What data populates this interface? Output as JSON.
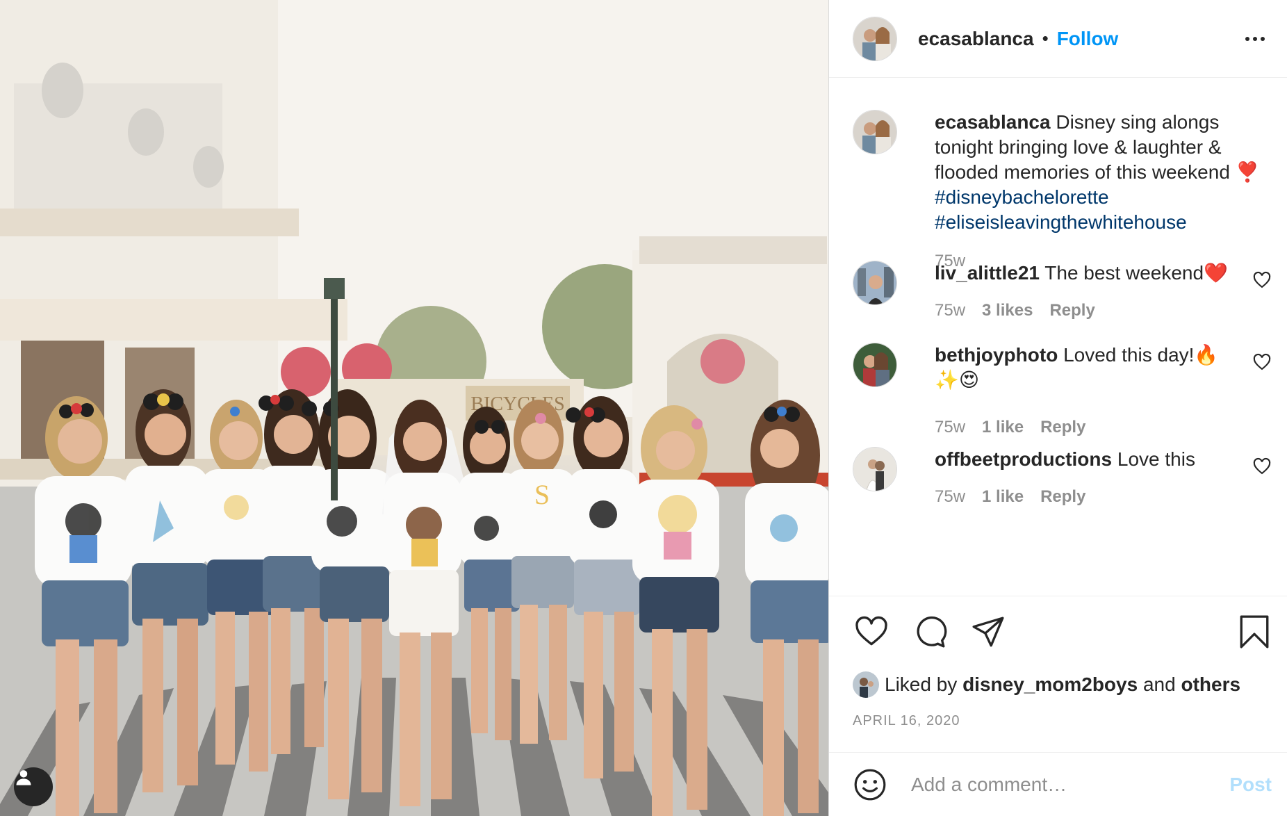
{
  "header": {
    "username": "ecasablanca",
    "separator": "•",
    "follow_label": "Follow"
  },
  "caption": {
    "username": "ecasablanca",
    "text": "Disney sing alongs tonight bringing love & laughter & flooded memories of this weekend ❣️",
    "hashtags": [
      "#disneybachelorette",
      "#eliseisleavingthewhitehouse"
    ],
    "time": "75w"
  },
  "comments": [
    {
      "username": "liv_alittle21",
      "text": "The best weekend❤️",
      "time": "75w",
      "likes": "3 likes",
      "reply": "Reply"
    },
    {
      "username": "bethjoyphoto",
      "text": "Loved this day!🔥✨😍",
      "time": "75w",
      "likes": "1 like",
      "reply": "Reply"
    },
    {
      "username": "offbeetproductions",
      "text": "Love this",
      "time": "75w",
      "likes": "1 like",
      "reply": "Reply"
    }
  ],
  "likes": {
    "prefix": "Liked by",
    "user": "disney_mom2boys",
    "middle": "and",
    "others": "others"
  },
  "date": "APRIL 16, 2020",
  "add_comment": {
    "placeholder": "Add a comment…",
    "post_label": "Post"
  },
  "photo": {
    "sign_text": "BICYCLES"
  },
  "colors": {
    "link_blue": "#0095f6",
    "hashtag_blue": "#00376b",
    "muted": "#8e8e8e",
    "post_disabled": "#b2dffc"
  },
  "icons": [
    "heart-icon",
    "comment-icon",
    "share-icon",
    "bookmark-icon",
    "emoji-icon",
    "more-icon",
    "user-tag-icon"
  ]
}
